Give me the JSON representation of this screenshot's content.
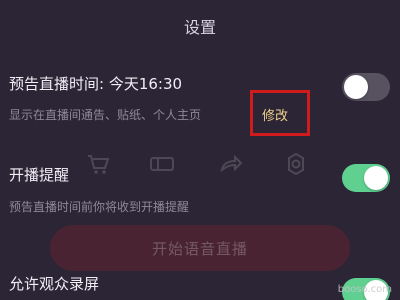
{
  "header": {
    "title": "设置"
  },
  "settings": {
    "scheduled_live": {
      "label": "预告直播时间: 今天16:30",
      "description": "显示在直播间通告、贴纸、个人主页",
      "edit_label": "修改",
      "enabled": false
    },
    "live_reminder": {
      "label": "开播提醒",
      "description": "预告直播时间前你将收到开播提醒",
      "enabled": true
    },
    "allow_recording": {
      "label": "允许观众录屏",
      "enabled": true
    }
  },
  "background": {
    "start_button_label": "开始语音直播",
    "icons": [
      {
        "name": "cart-icon"
      },
      {
        "name": "coupon-icon"
      },
      {
        "name": "share-icon"
      },
      {
        "name": "settings-icon"
      }
    ]
  },
  "watermark": {
    "text": "booso.com"
  },
  "colors": {
    "background": "#2b2536",
    "toggle_on": "#5fd08f",
    "toggle_off": "#575160",
    "edit_text": "#f0d28a",
    "highlight_border": "#cf1b1b"
  }
}
